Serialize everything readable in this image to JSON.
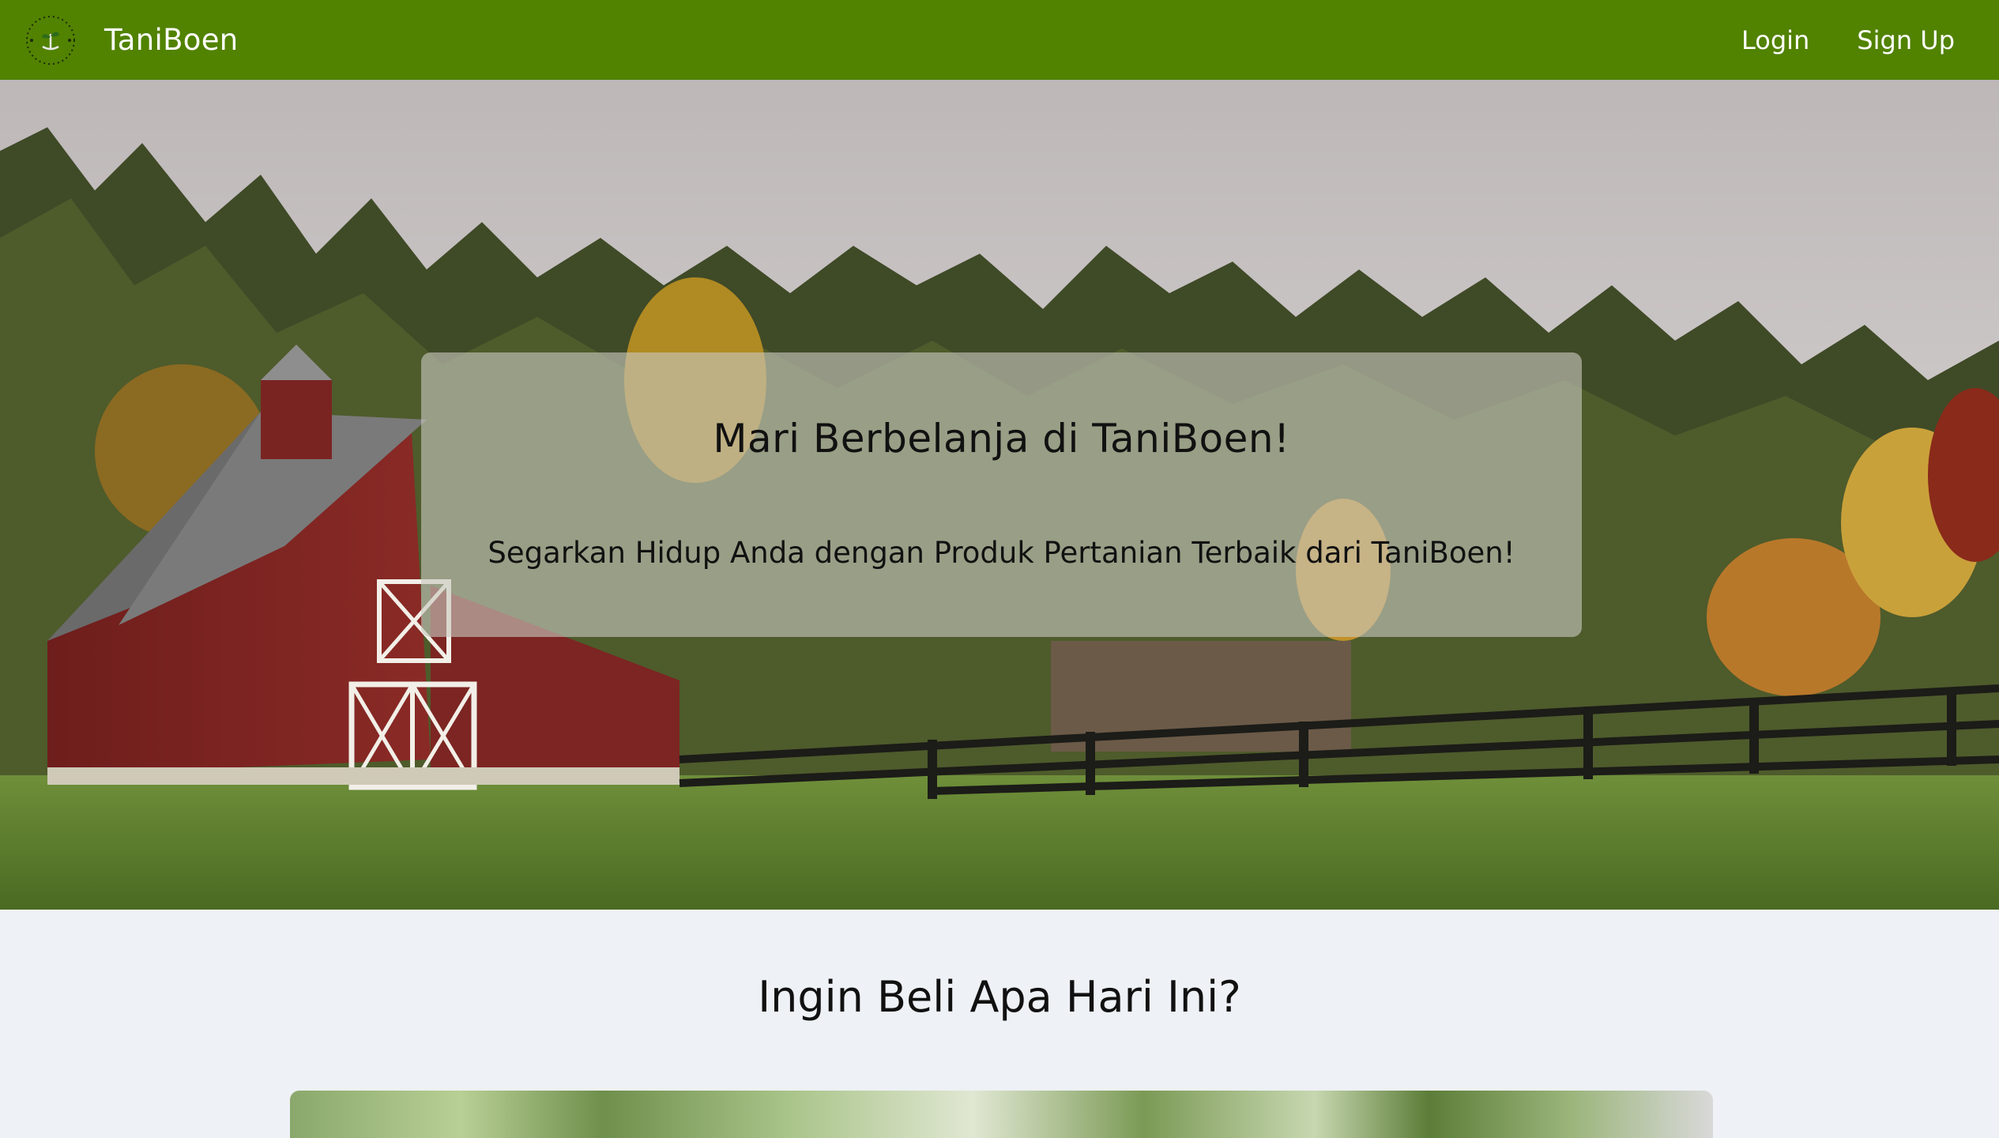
{
  "navbar": {
    "brand_name": "TaniBoen",
    "links": {
      "login": "Login",
      "signup": "Sign Up"
    },
    "background_color": "#518200"
  },
  "hero": {
    "title": "Mari Berbelanja di TaniBoen!",
    "subtitle": "Segarkan Hidup Anda dengan Produk Pertanian Terbaik dari TaniBoen!",
    "image_description_icon": "farm-barn-scene"
  },
  "section": {
    "title": "Ingin Beli Apa Hari Ini?"
  },
  "colors": {
    "page_background": "#eef1f5",
    "text": "#111111"
  }
}
